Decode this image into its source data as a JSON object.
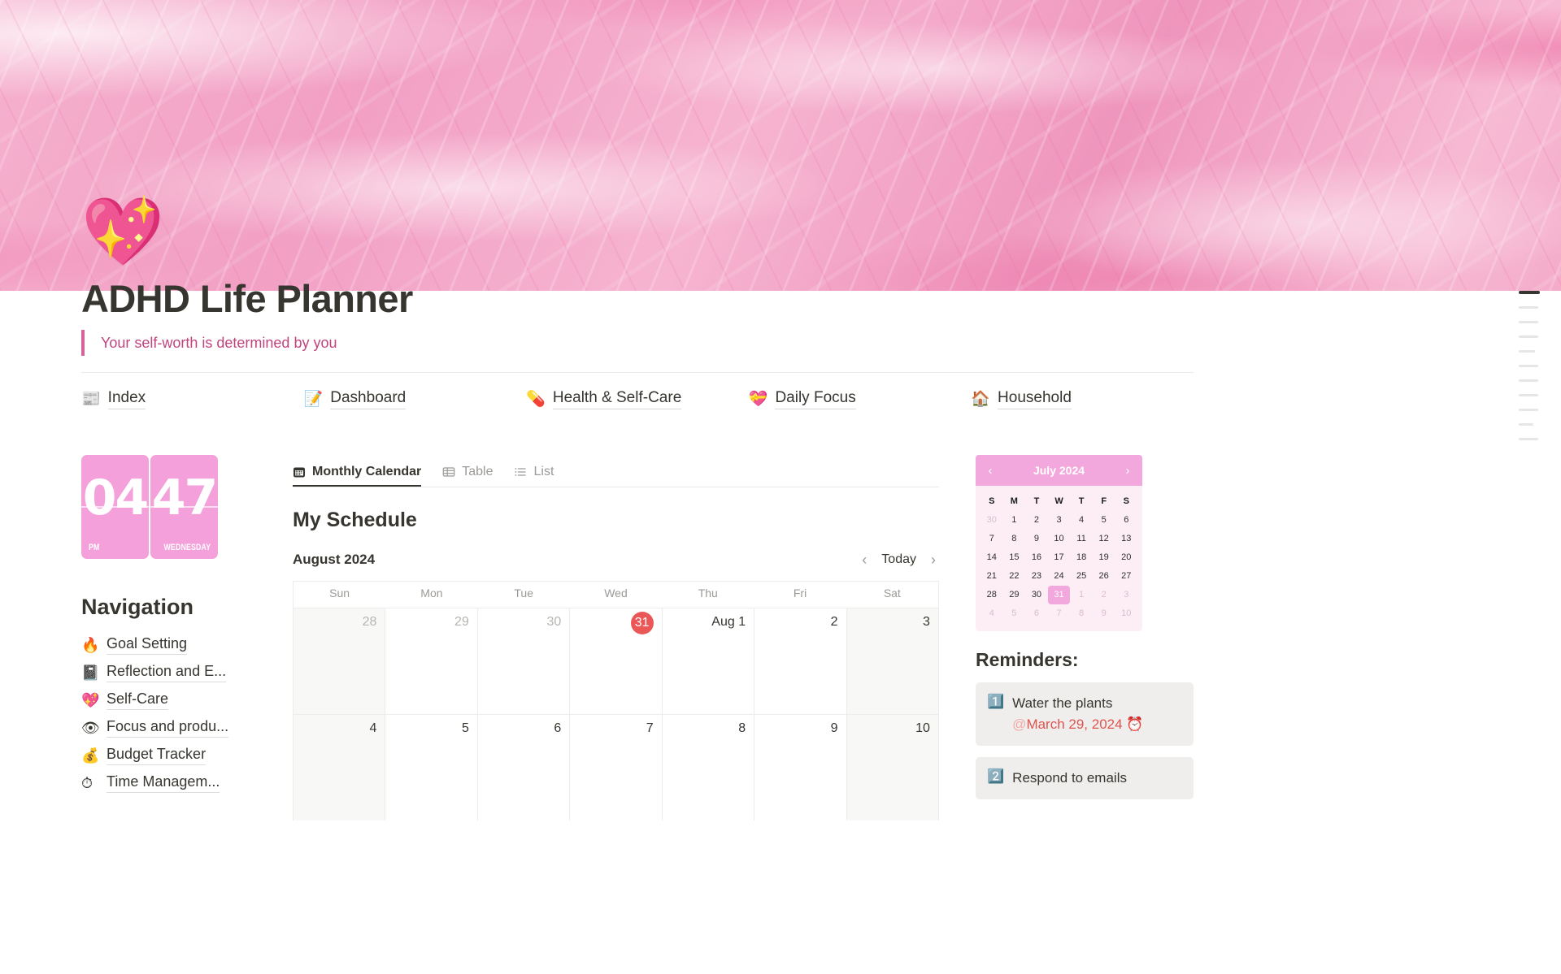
{
  "page": {
    "icon": "💖",
    "icon_name": "sparkling-heart-emoji",
    "title": "ADHD Life Planner",
    "quote": "Your self-worth is determined by you"
  },
  "theme": {
    "cover_pink": "#f3a6c7",
    "accent_pink": "#f2a7dd",
    "quote_color": "#c0447e",
    "today_red": "#eb5757",
    "reminder_date_red": "#e0544f"
  },
  "topnav": [
    {
      "emoji": "📰",
      "label": "Index"
    },
    {
      "emoji": "📝",
      "label": "Dashboard"
    },
    {
      "emoji": "💊",
      "label": "Health & Self-Care"
    },
    {
      "emoji": "💝",
      "label": "Daily Focus"
    },
    {
      "emoji": "🏠",
      "label": "Household"
    }
  ],
  "clock": {
    "hour": "04",
    "meridiem": "PM",
    "minute": "47",
    "weekday": "WEDNESDAY"
  },
  "navigation": {
    "heading": "Navigation",
    "items": [
      {
        "emoji": "🔥",
        "label": "Goal Setting"
      },
      {
        "emoji": "📓",
        "label": "Reflection and E..."
      },
      {
        "emoji": "💖",
        "label": "Self-Care"
      },
      {
        "emoji": "👁",
        "label": "Focus and produ..."
      },
      {
        "emoji": "💰",
        "label": "Budget Tracker"
      },
      {
        "emoji": "⏱",
        "label": "Time Managem..."
      }
    ]
  },
  "views": {
    "tabs": [
      {
        "label": "Monthly Calendar",
        "icon": "calendar-icon",
        "active": true
      },
      {
        "label": "Table",
        "icon": "table-icon",
        "active": false
      },
      {
        "label": "List",
        "icon": "list-icon",
        "active": false
      }
    ]
  },
  "schedule": {
    "title": "My Schedule",
    "month_label": "August 2024",
    "today_label": "Today",
    "prev_icon": "chevron-left-icon",
    "next_icon": "chevron-right-icon",
    "dow": [
      "Sun",
      "Mon",
      "Tue",
      "Wed",
      "Thu",
      "Fri",
      "Sat"
    ],
    "weeks": [
      [
        {
          "text": "28",
          "out": true
        },
        {
          "text": "29",
          "out": true
        },
        {
          "text": "30",
          "out": true
        },
        {
          "text": "31",
          "today": true
        },
        {
          "text": "Aug 1"
        },
        {
          "text": "2"
        },
        {
          "text": "3"
        }
      ],
      [
        {
          "text": "4"
        },
        {
          "text": "5"
        },
        {
          "text": "6"
        },
        {
          "text": "7"
        },
        {
          "text": "8"
        },
        {
          "text": "9"
        },
        {
          "text": "10"
        }
      ]
    ]
  },
  "mini_calendar": {
    "title": "July 2024",
    "prev_icon": "chevron-left-icon",
    "next_icon": "chevron-right-icon",
    "prev_glyph": "‹",
    "next_glyph": "›",
    "dow": [
      "S",
      "M",
      "T",
      "W",
      "T",
      "F",
      "S"
    ],
    "weeks": [
      [
        {
          "d": "30",
          "mut": true
        },
        {
          "d": "1"
        },
        {
          "d": "2"
        },
        {
          "d": "3"
        },
        {
          "d": "4"
        },
        {
          "d": "5"
        },
        {
          "d": "6"
        }
      ],
      [
        {
          "d": "7"
        },
        {
          "d": "8"
        },
        {
          "d": "9"
        },
        {
          "d": "10"
        },
        {
          "d": "11"
        },
        {
          "d": "12"
        },
        {
          "d": "13"
        }
      ],
      [
        {
          "d": "14"
        },
        {
          "d": "15"
        },
        {
          "d": "16"
        },
        {
          "d": "17"
        },
        {
          "d": "18"
        },
        {
          "d": "19"
        },
        {
          "d": "20"
        }
      ],
      [
        {
          "d": "21"
        },
        {
          "d": "22"
        },
        {
          "d": "23"
        },
        {
          "d": "24"
        },
        {
          "d": "25"
        },
        {
          "d": "26"
        },
        {
          "d": "27"
        }
      ],
      [
        {
          "d": "28"
        },
        {
          "d": "29"
        },
        {
          "d": "30"
        },
        {
          "d": "31",
          "sel": true
        },
        {
          "d": "1",
          "mut": true
        },
        {
          "d": "2",
          "mut": true
        },
        {
          "d": "3",
          "mut": true
        }
      ],
      [
        {
          "d": "4",
          "mut": true
        },
        {
          "d": "5",
          "mut": true
        },
        {
          "d": "6",
          "mut": true
        },
        {
          "d": "7",
          "mut": true
        },
        {
          "d": "8",
          "mut": true
        },
        {
          "d": "9",
          "mut": true
        },
        {
          "d": "10",
          "mut": true
        }
      ]
    ]
  },
  "reminders": {
    "heading": "Reminders:",
    "items": [
      {
        "num": "1️⃣",
        "text": "Water the plants",
        "at": "@",
        "date": "March 29, 2024",
        "alarm": "⏰"
      },
      {
        "num": "2️⃣",
        "text": "Respond to emails",
        "at": "",
        "date": "",
        "alarm": ""
      }
    ]
  },
  "toc": {
    "ticks": [
      {
        "active": true
      },
      {
        "active": false
      },
      {
        "active": false
      },
      {
        "active": false
      },
      {
        "active": false
      },
      {
        "active": false
      },
      {
        "active": false
      },
      {
        "active": false
      },
      {
        "active": false
      },
      {
        "active": false
      },
      {
        "active": false
      }
    ]
  }
}
